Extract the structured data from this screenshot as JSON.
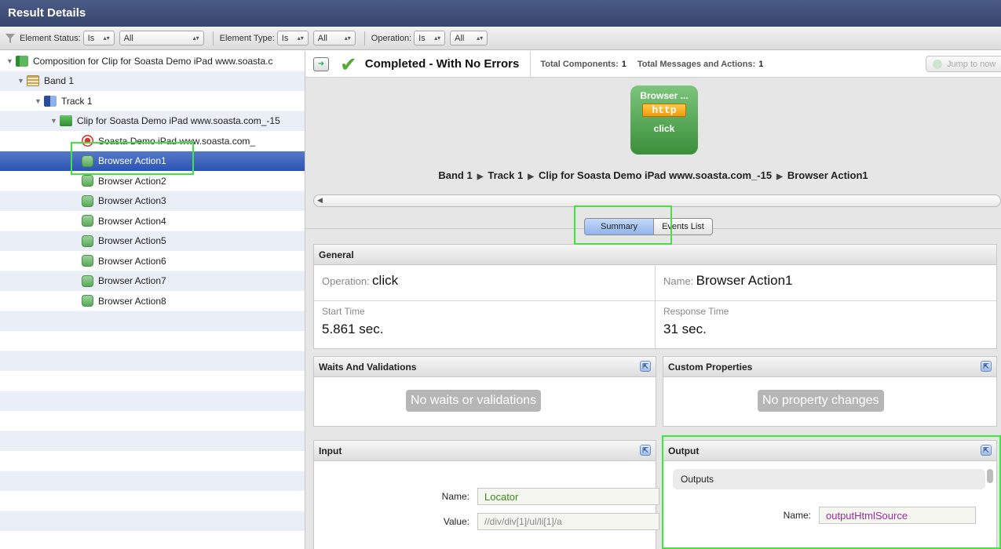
{
  "window": {
    "title": "Result Details"
  },
  "filters": [
    {
      "label": "Element Status:",
      "op": "Is",
      "value": "All"
    },
    {
      "label": "Element Type:",
      "op": "Is",
      "value": "All"
    },
    {
      "label": "Operation:",
      "op": "Is",
      "value": "All"
    }
  ],
  "tree": {
    "items": [
      {
        "label": "Composition for Clip for Soasta Demo iPad www.soasta.c",
        "icon": "composition-icon"
      },
      {
        "label": "Band 1",
        "icon": "band-icon"
      },
      {
        "label": "Track 1",
        "icon": "track-icon"
      },
      {
        "label": "Clip for Soasta Demo iPad www.soasta.com_-15",
        "icon": "clip-icon"
      },
      {
        "label": "Soasta Demo iPad www.soasta.com_",
        "icon": "record-icon"
      },
      {
        "label": "Browser Action1",
        "icon": "browser-action-icon",
        "selected": true
      },
      {
        "label": "Browser Action2",
        "icon": "browser-action-icon"
      },
      {
        "label": "Browser Action3",
        "icon": "browser-action-icon"
      },
      {
        "label": "Browser Action4",
        "icon": "browser-action-icon"
      },
      {
        "label": "Browser Action5",
        "icon": "browser-action-icon"
      },
      {
        "label": "Browser Action6",
        "icon": "browser-action-icon"
      },
      {
        "label": "Browser Action7",
        "icon": "browser-action-icon"
      },
      {
        "label": "Browser Action8",
        "icon": "browser-action-icon"
      }
    ]
  },
  "status": {
    "text": "Completed - With No Errors",
    "total_components_label": "Total Components:",
    "total_components": "1",
    "total_messages_label": "Total Messages and Actions:",
    "total_messages": "1",
    "jump_label": "Jump to now"
  },
  "tile": {
    "name": "Browser ...",
    "badge": "http",
    "operation": "click"
  },
  "breadcrumb": [
    "Band 1",
    "Track 1",
    "Clip for Soasta Demo iPad www.soasta.com_-15",
    "Browser Action1"
  ],
  "tabs": {
    "summary": "Summary",
    "events": "Events List"
  },
  "general": {
    "title": "General",
    "operation_label": "Operation:",
    "operation_value": "click",
    "name_label": "Name:",
    "name_value": "Browser Action1",
    "start_label": "Start Time",
    "start_value": "5.861 sec.",
    "response_label": "Response Time",
    "response_value": "31 sec."
  },
  "waits": {
    "title": "Waits And Validations",
    "empty": "No waits or validations"
  },
  "custom": {
    "title": "Custom Properties",
    "empty": "No property changes"
  },
  "input": {
    "title": "Input",
    "name_label": "Name:",
    "name_value": "Locator",
    "value_label": "Value:",
    "value_value": "//div/div[1]/ul/li[1]/a"
  },
  "output": {
    "title": "Output",
    "section": "Outputs",
    "name_label": "Name:",
    "name_value": "outputHtmlSource"
  },
  "colors": {
    "accent_green": "#3de83d",
    "title_bg": "#3f4f79",
    "selection": "#2c54b4"
  }
}
